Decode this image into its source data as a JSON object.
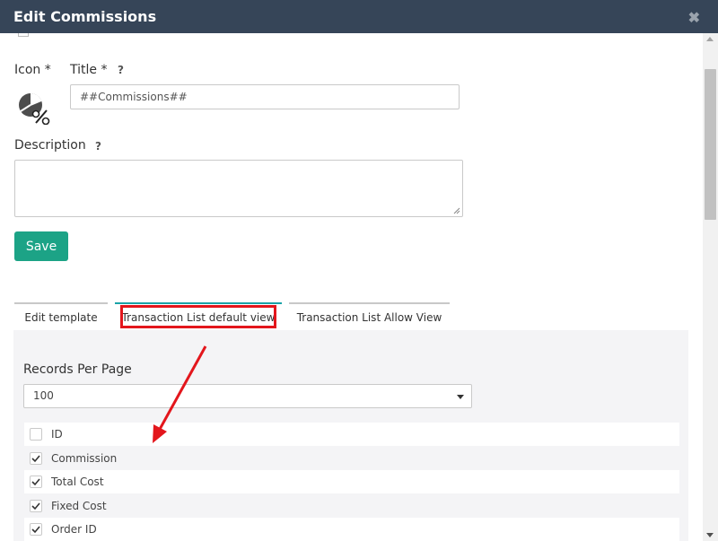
{
  "dialog": {
    "title": "Edit Commissions",
    "close_glyph": "✖"
  },
  "form": {
    "icon_label": "Icon *",
    "title_label": "Title *",
    "help_glyph": "?",
    "title_value": "##Commissions##",
    "description_label": "Description",
    "description_value": "",
    "save_label": "Save",
    "icon_name": "pie-percent-icon"
  },
  "tabs": [
    {
      "label": "Edit template"
    },
    {
      "label": "Transaction List default view"
    },
    {
      "label": "Transaction List Allow View"
    }
  ],
  "active_tab": 1,
  "records_per_page": {
    "label": "Records Per Page",
    "selected": "100"
  },
  "columns": [
    {
      "label": "ID",
      "checked": false
    },
    {
      "label": "Commission",
      "checked": true
    },
    {
      "label": "Total Cost",
      "checked": true
    },
    {
      "label": "Fixed Cost",
      "checked": true
    },
    {
      "label": "Order ID",
      "checked": true
    }
  ],
  "colors": {
    "header_bg": "#364558",
    "save_bg": "#1ca386",
    "active_tab_accent": "#1aa3a8",
    "annotation_red": "#e3161c"
  }
}
